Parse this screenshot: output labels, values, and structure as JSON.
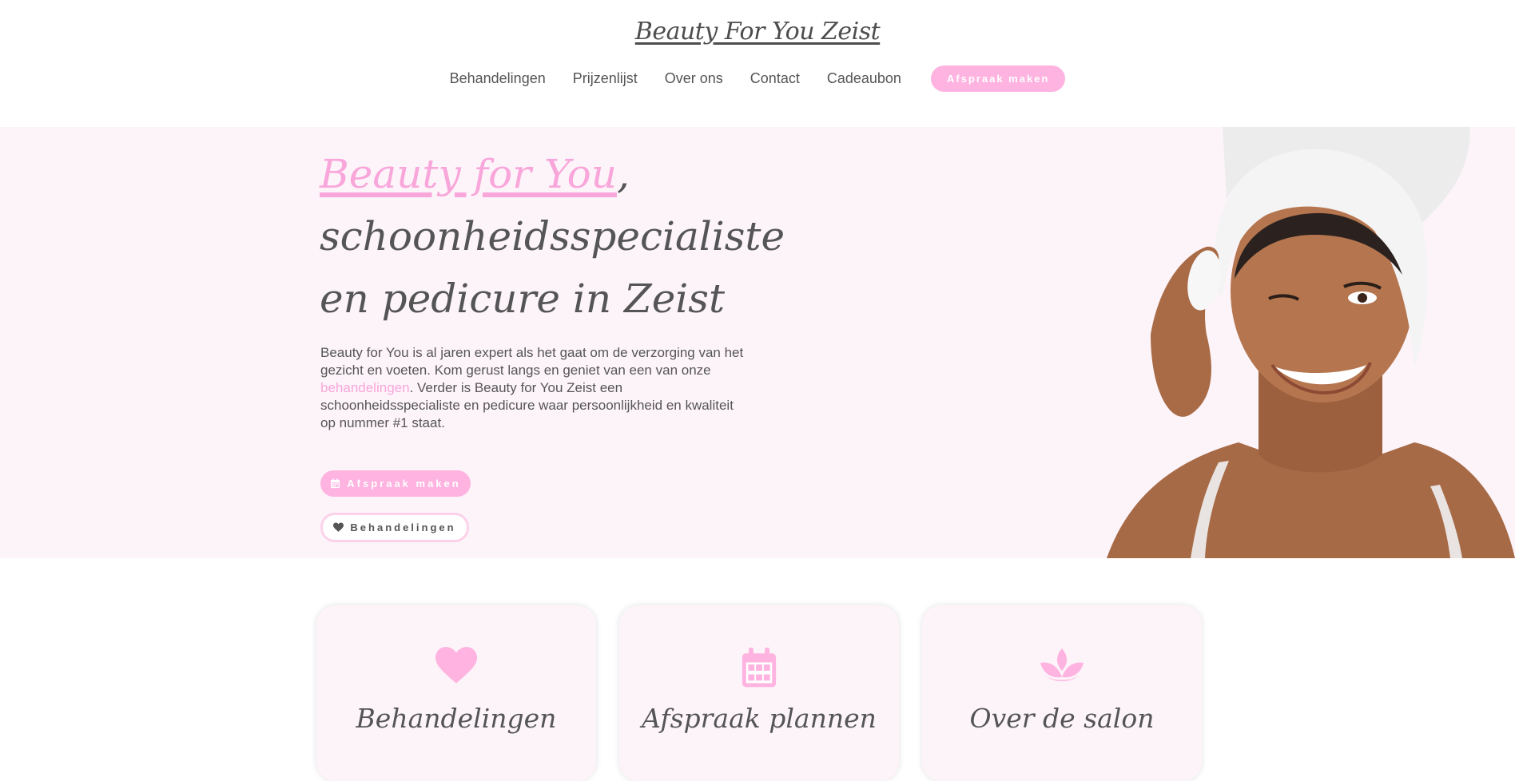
{
  "header": {
    "brand": "Beauty For You Zeist",
    "nav": [
      "Behandelingen",
      "Prijzenlijst",
      "Over ons",
      "Contact",
      "Cadeaubon"
    ],
    "cta": "Afspraak maken"
  },
  "hero": {
    "title_highlight": "Beauty for You",
    "title_comma": ",",
    "title_rest": "schoonheidsspecialiste en pedicure in Zeist",
    "text_part1": "Beauty for You is al jaren expert als het gaat om de verzorging van het gezicht en voeten. Kom gerust langs en geniet van een van onze ",
    "text_link": "behandelingen",
    "text_part2": ". Verder is Beauty for You Zeist een schoonheidsspecialiste en pedicure waar persoonlijkheid en kwaliteit op nummer #1 staat.",
    "primary_button": "Afspraak maken",
    "secondary_button": "Behandelingen"
  },
  "cards": [
    {
      "title": "Behandelingen",
      "icon": "heart-icon"
    },
    {
      "title": "Afspraak plannen",
      "icon": "calendar-icon"
    },
    {
      "title": "Over de salon",
      "icon": "lotus-icon"
    }
  ],
  "colors": {
    "accent": "#ffb3e0",
    "accent_text": "#f9a6da",
    "hero_bg": "#fdf4fa",
    "text": "#555555"
  }
}
